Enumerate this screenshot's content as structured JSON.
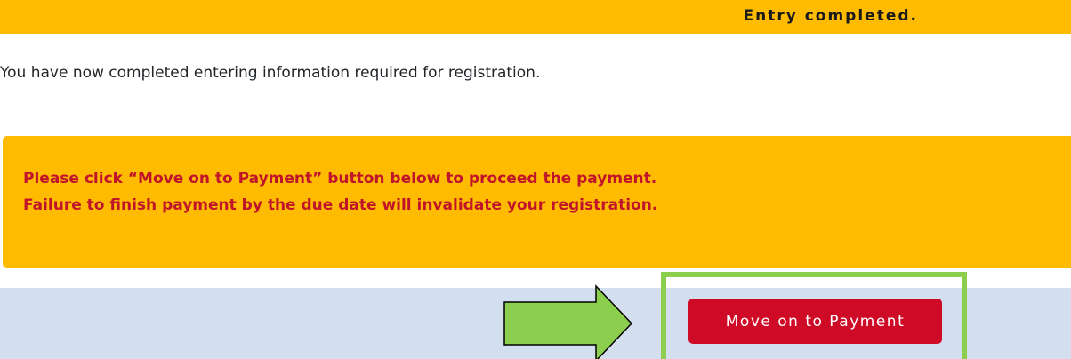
{
  "banner": {
    "status_text": "Entry completed.",
    "color": "#ffbb00"
  },
  "intro": {
    "text": "You have now completed entering information required for registration."
  },
  "notice": {
    "line1": "Please click “Move on to Payment” button below to proceed the payment.",
    "line2": "Failure to finish payment by the due date will invalidate your registration.",
    "text_color": "#c0142b",
    "background": "#ffbb00"
  },
  "action": {
    "pay_button_label": "Move on to Payment",
    "pay_button_color": "#cf0a27",
    "bar_color": "#d3deee",
    "highlight_color": "#8ccf4e",
    "pointer_icon": "right-arrow-icon"
  }
}
